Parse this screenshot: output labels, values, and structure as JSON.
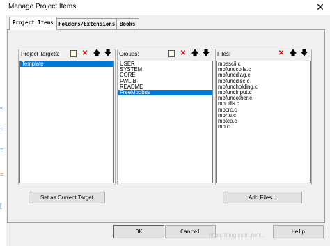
{
  "window": {
    "title": "Manage Project Items",
    "close_glyph": "✕"
  },
  "background_glyphs": [
    "<",
    "=",
    "=",
    "=",
    "["
  ],
  "tabs": [
    {
      "label": "Project Items"
    },
    {
      "label": "Folders/Extensions"
    },
    {
      "label": "Books"
    }
  ],
  "targets": {
    "title": "Project Targets:",
    "items": [
      "Template"
    ],
    "selected": 0
  },
  "groups": {
    "title": "Groups:",
    "items": [
      "USER",
      "SYSTEM",
      "CORE",
      "FWLIB",
      "README",
      "FreeModbus"
    ],
    "selected": 5
  },
  "files": {
    "title": "Files:",
    "items": [
      "mbascii.c",
      "mbfunccoils.c",
      "mbfuncdiag.c",
      "mbfuncdisc.c",
      "mbfuncholding.c",
      "mbfuncinput.c",
      "mbfuncother.c",
      "mbutils.c",
      "mbcrc.c",
      "mbrtu.c",
      "mbtcp.c",
      "mb.c"
    ]
  },
  "toolbar_icons": {
    "new": "new-item-icon",
    "delete": "delete-icon",
    "up": "move-up-icon",
    "down": "move-down-icon"
  },
  "toolbar_glyphs": {
    "delete": "✕",
    "up": "🡅",
    "down": "🡇"
  },
  "buttons": {
    "set_current": "Set as Current Target",
    "add_files": "Add Files...",
    "ok": "OK",
    "cancel": "Cancel",
    "help": "Help"
  },
  "watermark": "https://blog.csdn.net/..."
}
